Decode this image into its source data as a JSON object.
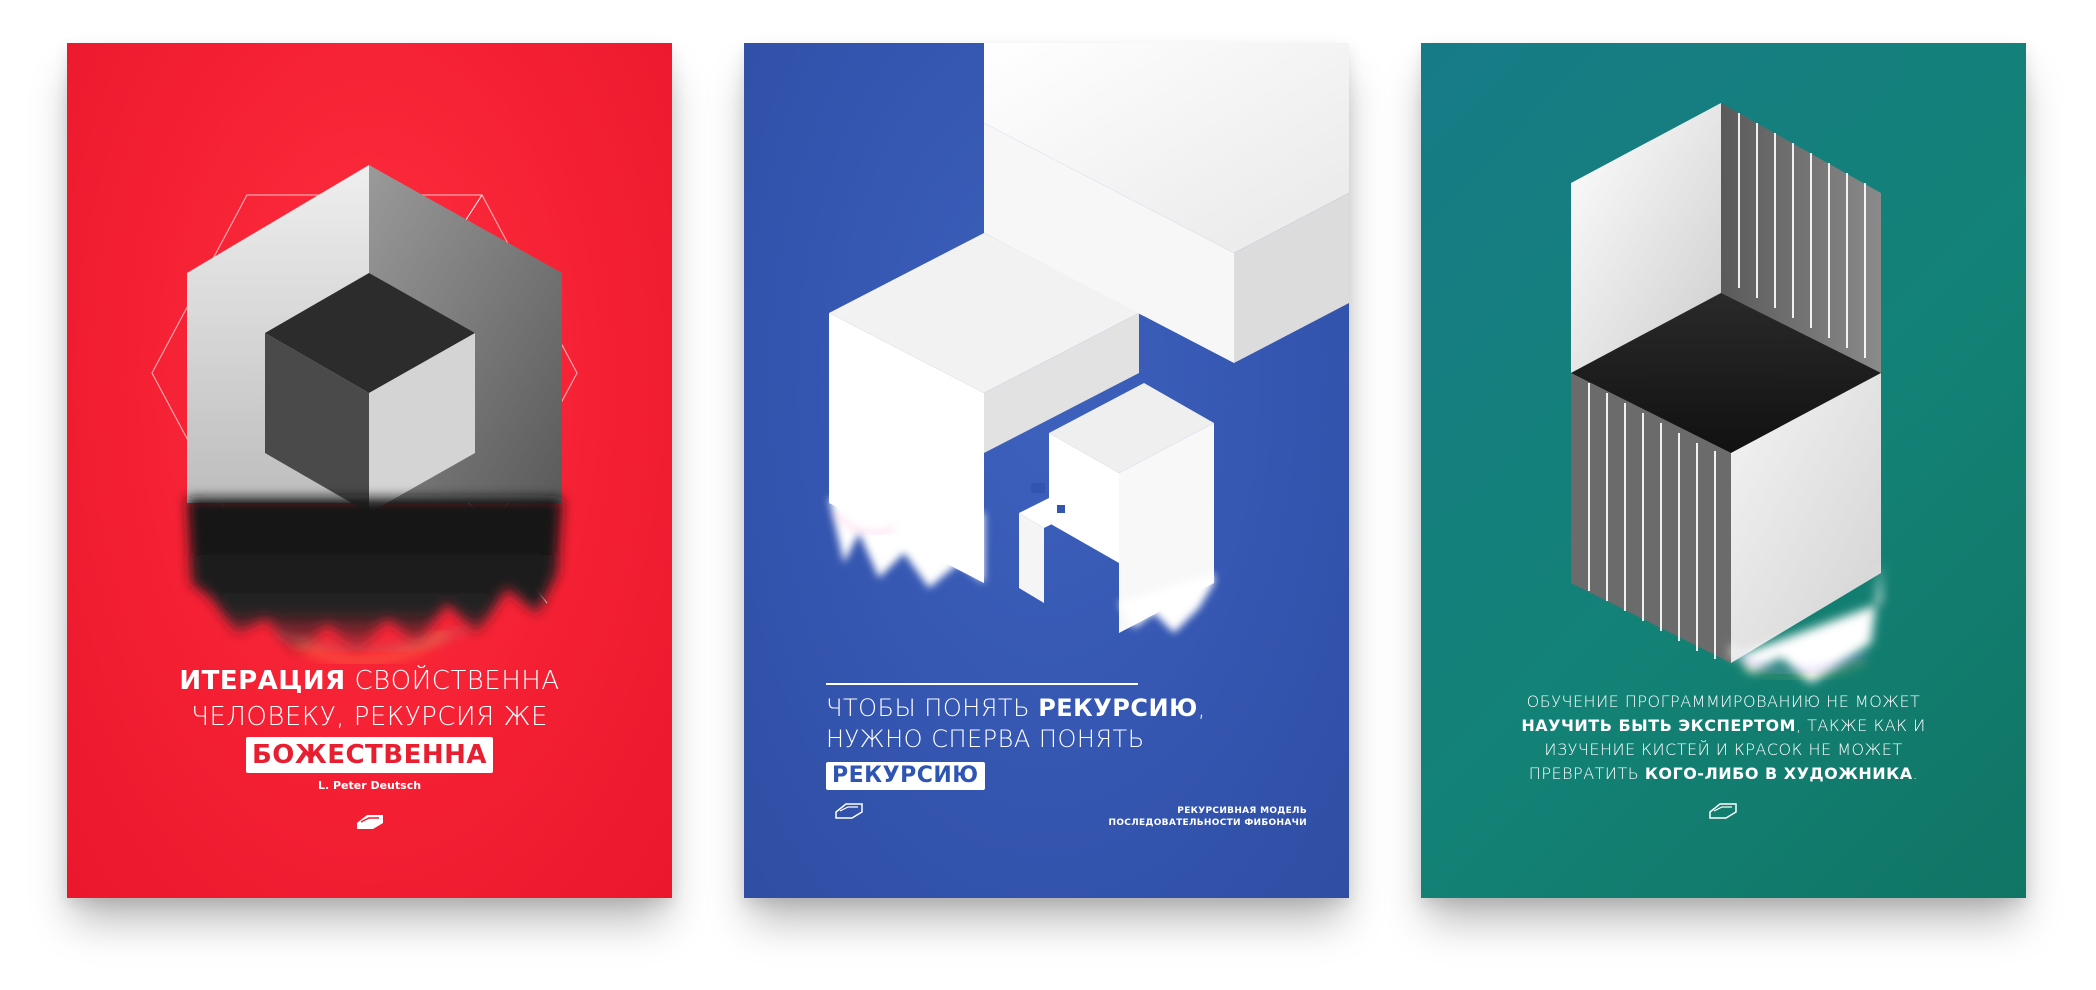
{
  "colors": {
    "red_poster": "#f41f33",
    "blue_poster": "#3455af",
    "teal_poster": "#138276",
    "text": "#ffffff"
  },
  "poster_red": {
    "line1_bold": "ИТЕРАЦИЯ",
    "line1_rest": " СВОЙСТВЕННА",
    "line2": "ЧЕЛОВЕКУ, РЕКУРСИЯ ЖЕ",
    "highlight": "БОЖЕСТВЕННА",
    "author": "L. Peter Deutsch",
    "logo_icon": "studio-logo-icon"
  },
  "poster_blue": {
    "line1_light": "ЧТОБЫ ПОНЯТЬ ",
    "line1_bold": "РЕКУРСИЮ",
    "line1_end": ",",
    "line2": "НУЖНО СПЕРВА ПОНЯТЬ",
    "highlight": "РЕКУРСИЮ",
    "caption_line1": "РЕКУРСИВНАЯ МОДЕЛЬ",
    "caption_line2": "ПОСЛЕДОВАТЕЛЬНОСТИ ФИБОНАЧИ",
    "logo_icon": "studio-logo-icon"
  },
  "poster_teal": {
    "line1": "ОБУЧЕНИЕ ПРОГРАММИРОВАНИЮ НЕ МОЖЕТ",
    "line2_bold": "НАУЧИТЬ БЫТЬ ЭКСПЕРТОМ",
    "line2_rest": ", ТАКЖЕ КАК И",
    "line3": "ИЗУЧЕНИЕ КИСТЕЙ И КРАСОК НЕ МОЖЕТ",
    "line4_light": "ПРЕВРАТИТЬ ",
    "line4_bold": "КОГО-ЛИБО В ХУДОЖНИКА",
    "line4_end": ".",
    "logo_icon": "studio-logo-icon"
  }
}
